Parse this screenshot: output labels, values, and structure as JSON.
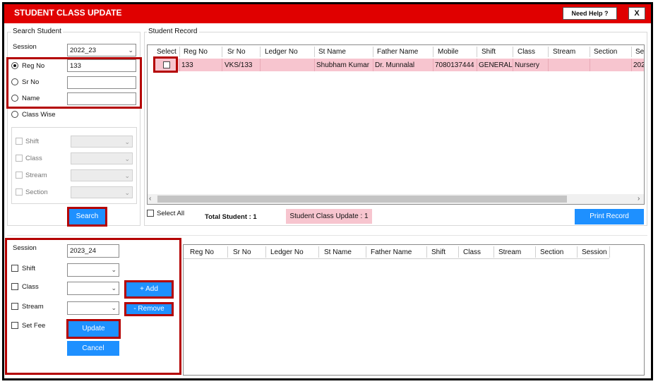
{
  "window": {
    "title": "STUDENT CLASS UPDATE",
    "help_label": "Need Help ?",
    "close_label": "X"
  },
  "search_panel": {
    "legend": "Search Student",
    "session_label": "Session",
    "session_value": "2022_23",
    "reg_no_label": "Reg No",
    "reg_no_value": "133",
    "sr_no_label": "Sr No",
    "name_label": "Name",
    "class_wise_label": "Class Wise",
    "shift_label": "Shift",
    "class_label": "Class",
    "stream_label": "Stream",
    "section_label": "Section",
    "search_label": "Search"
  },
  "record_panel": {
    "legend": "Student Record",
    "columns": [
      "Select",
      "Reg No",
      "Sr No",
      "Ledger No",
      "St Name",
      "Father Name",
      "Mobile",
      "Shift",
      "Class",
      "Stream",
      "Section",
      "Ses"
    ],
    "rows": [
      {
        "reg_no": "133",
        "sr_no": "VKS/133",
        "ledger_no": "",
        "st_name": "Shubham Kumar",
        "father_name": "Dr. Munnalal",
        "mobile": "7080137444",
        "shift": "GENERAL",
        "class": "Nursery",
        "stream": "",
        "section": "",
        "session": "202"
      }
    ],
    "select_all_label": "Select All",
    "total_label": "Total Student : 1",
    "update_status": "Student Class Update : 1",
    "print_label": "Print Record"
  },
  "update_panel": {
    "session_label": "Session",
    "session_value": "2023_24",
    "shift_label": "Shift",
    "class_label": "Class",
    "stream_label": "Stream",
    "set_fee_label": "Set Fee",
    "add_label": "+ Add",
    "remove_label": "- Remove",
    "update_label": "Update",
    "cancel_label": "Cancel"
  },
  "bottom_grid": {
    "columns": [
      "Reg No",
      "Sr No",
      "Ledger No",
      "St Name",
      "Father Name",
      "Shift",
      "Class",
      "Stream",
      "Section",
      "Session"
    ]
  },
  "colors": {
    "title_bar": "#e00000",
    "highlight": "#b40000",
    "button": "#1e90ff",
    "row_selected": "#f7c5cf"
  }
}
